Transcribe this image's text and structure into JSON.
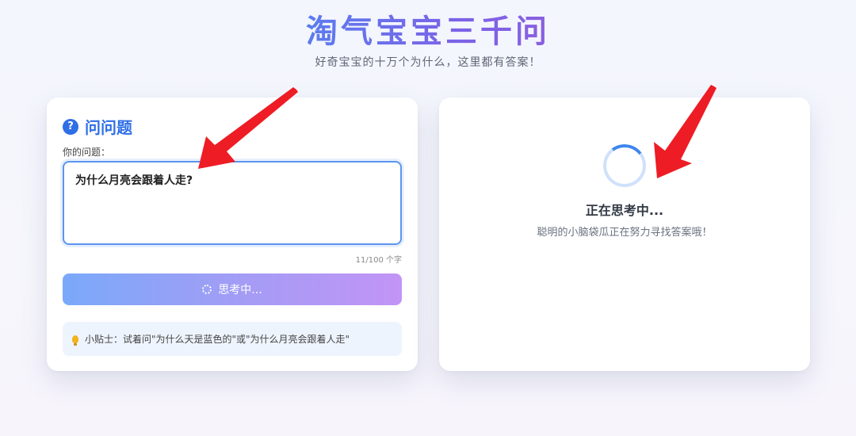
{
  "header": {
    "title": "淘气宝宝三千问",
    "subtitle": "好奇宝宝的十万个为什么，这里都有答案！"
  },
  "ask_panel": {
    "icon": "question-circle-icon",
    "title": "问问题",
    "question_label": "你的问题：",
    "question_value": "为什么月亮会跟着人走?",
    "char_count": "11/100 个字",
    "button_label": "思考中...",
    "tip_icon": "lightbulb-icon",
    "tip_text": "小贴士：试着问\"为什么天是蓝色的\"或\"为什么月亮会跟着人走\""
  },
  "answer_panel": {
    "status_title": "正在思考中...",
    "status_subtitle": "聪明的小脑袋瓜正在努力寻找答案哦！"
  },
  "colors": {
    "accent": "#2f6fe6",
    "title_gradient_start": "#5b7cf0",
    "title_gradient_end": "#8a5fe0",
    "button_gradient_start": "#7aa9fa",
    "button_gradient_end": "#c294f6",
    "annotation_arrow": "#ee1c25"
  }
}
